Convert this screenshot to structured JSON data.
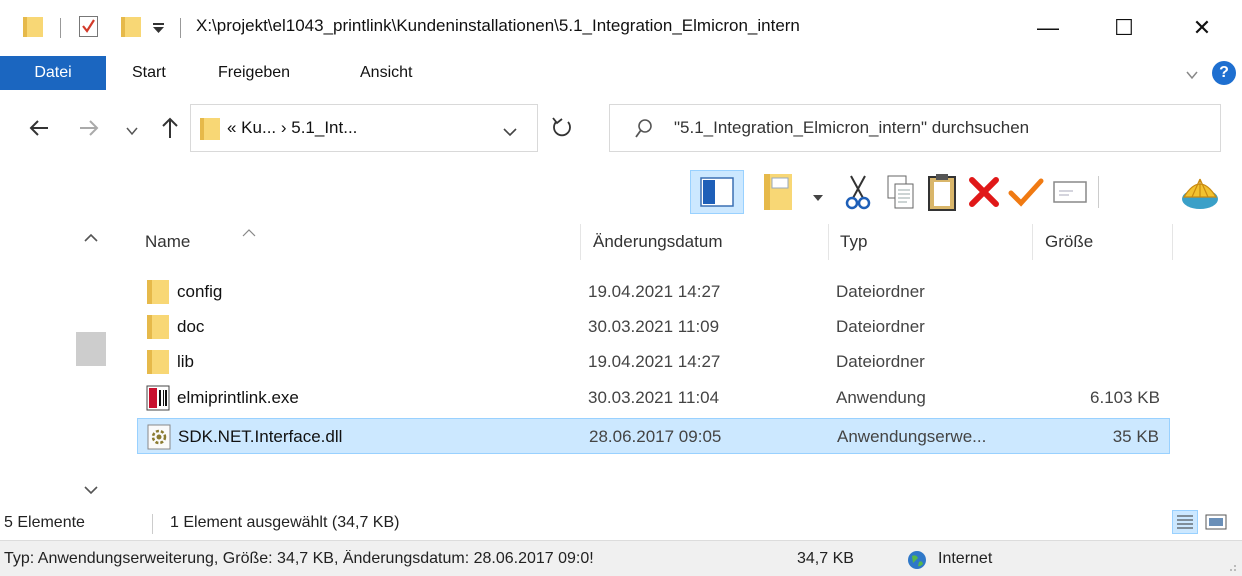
{
  "window": {
    "path": "X:\\projekt\\el1043_printlink\\Kundeninstallationen\\5.1_Integration_Elmicron_intern",
    "minimize": "—",
    "maximize": "☐",
    "close": "✕"
  },
  "ribbon": {
    "tabs": [
      "Datei",
      "Start",
      "Freigeben",
      "Ansicht"
    ],
    "help": "?"
  },
  "nav": {
    "address": "«  Ku...  ›  5.1_Int...",
    "search_placeholder": "\"5.1_Integration_Elmicron_intern\" durchsuchen"
  },
  "columns": {
    "name": "Name",
    "date": "Änderungsdatum",
    "type": "Typ",
    "size": "Größe"
  },
  "files": [
    {
      "name": "config",
      "date": "19.04.2021 14:27",
      "type": "Dateiordner",
      "size": "",
      "icon": "folder-icon"
    },
    {
      "name": "doc",
      "date": "30.03.2021 11:09",
      "type": "Dateiordner",
      "size": "",
      "icon": "folder-icon"
    },
    {
      "name": "lib",
      "date": "19.04.2021 14:27",
      "type": "Dateiordner",
      "size": "",
      "icon": "folder-icon"
    },
    {
      "name": "elmiprintlink.exe",
      "date": "30.03.2021 11:04",
      "type": "Anwendung",
      "size": "6.103 KB",
      "icon": "exe-icon"
    },
    {
      "name": "SDK.NET.Interface.dll",
      "date": "28.06.2017 09:05",
      "type": "Anwendungserwe...",
      "size": "35 KB",
      "icon": "dll-icon",
      "selected": true
    }
  ],
  "status": {
    "count": "5 Elemente",
    "selection": "1 Element ausgewählt (34,7 KB)",
    "details": "Typ: Anwendungserweiterung, Größe: 34,7 KB, Änderungsdatum: 28.06.2017 09:0!",
    "size": "34,7 KB",
    "zone": "Internet"
  },
  "colors": {
    "accent": "#1b66c0",
    "selection": "#cce8ff",
    "highlight": "#e6ff2e",
    "folder": "#f8d775"
  }
}
